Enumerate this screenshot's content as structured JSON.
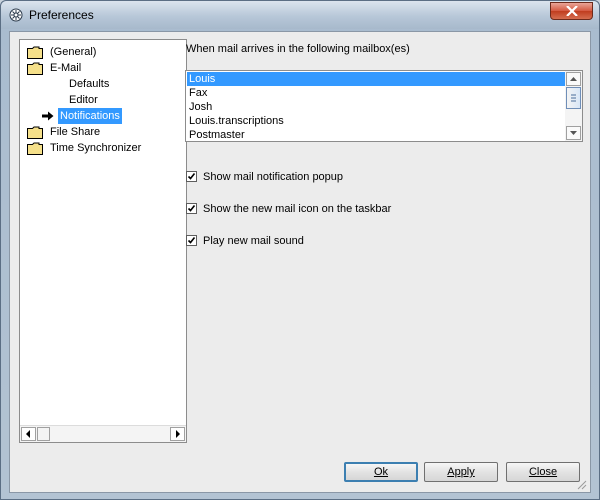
{
  "window": {
    "title": "Preferences"
  },
  "tree": {
    "items": [
      {
        "label": "(General)",
        "icon": "folder-icon"
      },
      {
        "label": "E-Mail",
        "icon": "folder-icon"
      },
      {
        "label": "Defaults",
        "icon": ""
      },
      {
        "label": "Editor",
        "icon": ""
      },
      {
        "label": "Notifications",
        "icon": "arrow-right-icon",
        "selected": true
      },
      {
        "label": "File Share",
        "icon": "folder-icon"
      },
      {
        "label": "Time Synchronizer",
        "icon": "folder-icon"
      }
    ]
  },
  "mailbox": {
    "prompt": "When mail arrives in the following mailbox(es)",
    "items": [
      "Louis",
      "Fax",
      "Josh",
      "Louis.transcriptions",
      "Postmaster"
    ],
    "selected": "Louis"
  },
  "options": {
    "popup_label": "Show mail notification popup",
    "popup_checked": true,
    "taskbar_label": "Show the new mail icon on the taskbar",
    "taskbar_checked": true,
    "sound_label": "Play new mail sound",
    "sound_checked": true
  },
  "buttons": {
    "ok": "Ok",
    "apply": "Apply",
    "close": "Close"
  },
  "colors": {
    "selection": "#3399ff",
    "folder": "#f5e08a"
  }
}
